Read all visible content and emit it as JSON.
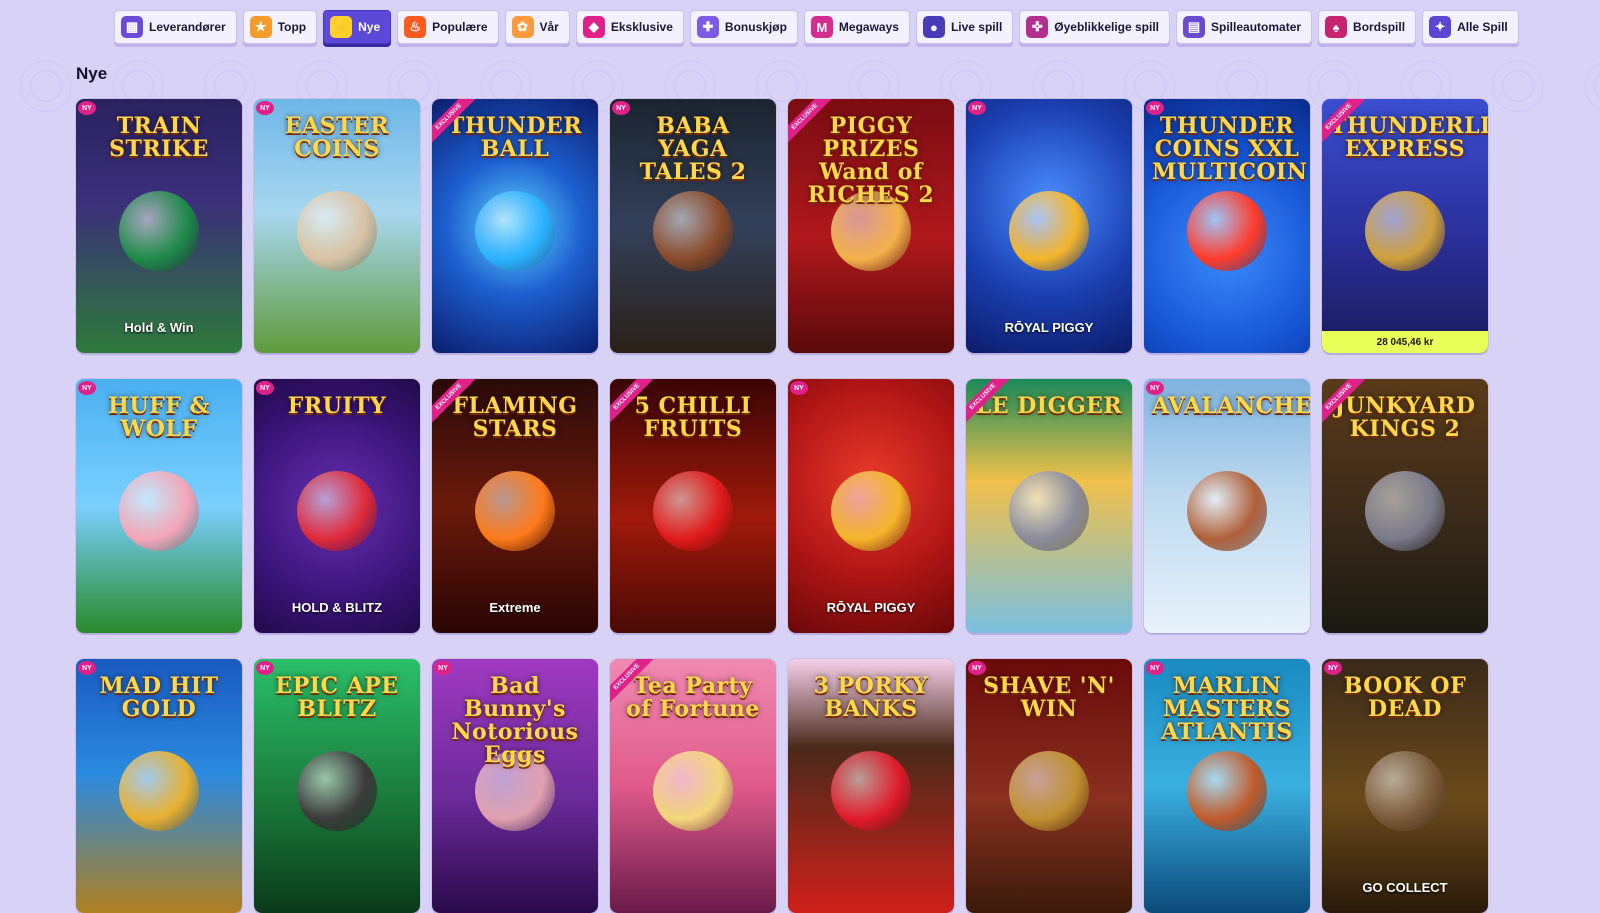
{
  "nav": [
    {
      "label": "Leverandører",
      "icon": "providers-icon",
      "color": "#6b4ad8",
      "glyph": "▦",
      "active": false
    },
    {
      "label": "Topp",
      "icon": "top-icon",
      "color": "#f39b2b",
      "glyph": "★",
      "active": false
    },
    {
      "label": "Nye",
      "icon": "new-icon",
      "color": "#ffcf2b",
      "glyph": "⚡",
      "active": true
    },
    {
      "label": "Populære",
      "icon": "fire-icon",
      "color": "#ff5a1f",
      "glyph": "♨",
      "active": false
    },
    {
      "label": "Vår",
      "icon": "butterfly-icon",
      "color": "#ff9a3c",
      "glyph": "✿",
      "active": false
    },
    {
      "label": "Eksklusive",
      "icon": "gem-icon",
      "color": "#e0218a",
      "glyph": "◆",
      "active": false
    },
    {
      "label": "Bonuskjøp",
      "icon": "gift-icon",
      "color": "#7d5be6",
      "glyph": "✚",
      "active": false
    },
    {
      "label": "Megaways",
      "icon": "megaways-icon",
      "color": "#d42c8f",
      "glyph": "M",
      "active": false
    },
    {
      "label": "Live spill",
      "icon": "live-icon",
      "color": "#4a3bb8",
      "glyph": "●",
      "active": false
    },
    {
      "label": "Øyeblikkelige spill",
      "icon": "gamepad-icon",
      "color": "#b22f8e",
      "glyph": "✜",
      "active": false
    },
    {
      "label": "Spilleautomater",
      "icon": "slot-machine-icon",
      "color": "#6a4ad0",
      "glyph": "▤",
      "active": false
    },
    {
      "label": "Bordspill",
      "icon": "cards-icon",
      "color": "#c8236f",
      "glyph": "♠",
      "active": false
    },
    {
      "label": "Alle Spill",
      "icon": "all-games-icon",
      "color": "#5b46d4",
      "glyph": "✦",
      "active": false
    }
  ],
  "section_title": "Nye",
  "games": [
    {
      "title": "TRAIN STRIKE",
      "sub": "Hold & Win",
      "badge": "NY",
      "exclusive": false,
      "bg": "linear-gradient(180deg,#2a2260 0%,#3b2f7a 40%,#2d7a3a 100%)",
      "emblem": "#1f8a4a"
    },
    {
      "title": "EASTER COINS",
      "sub": "",
      "badge": "NY",
      "exclusive": false,
      "bg": "linear-gradient(180deg,#6fb7e8 0%,#a8d7ef 45%,#5f9a3a 100%)",
      "emblem": "#d9c2a4"
    },
    {
      "title": "THUNDER BALL",
      "sub": "",
      "badge": "",
      "exclusive": true,
      "bg": "radial-gradient(circle at 50% 50%,#5fd8ff 0%,#1d5fd0 45%,#0b1d6e 100%)",
      "emblem": "#2ab3ff"
    },
    {
      "title": "BABA YAGA TALES 2",
      "sub": "",
      "badge": "NY",
      "exclusive": false,
      "bg": "linear-gradient(180deg,#1b2430 0%,#33405a 50%,#2a2018 100%)",
      "emblem": "#8a4a2a"
    },
    {
      "title": "PIGGY PRIZES Wand of RICHES 2",
      "sub": "",
      "badge": "",
      "exclusive": true,
      "bg": "linear-gradient(180deg,#7a0d12 0%,#b0181c 55%,#5a0a0a 100%)",
      "emblem": "#f3b24a"
    },
    {
      "title": "",
      "sub": "RŌYAL PIGGY",
      "badge": "NY",
      "exclusive": false,
      "bg": "radial-gradient(circle at 50% 40%,#4a8cff 0%,#1a3fb0 55%,#0c1c6a 100%)",
      "emblem": "#f5b52a"
    },
    {
      "title": "THUNDER COINS XXL MULTICOIN",
      "sub": "",
      "badge": "NY",
      "exclusive": false,
      "bg": "radial-gradient(circle at 50% 60%,#3b8bff 0%,#1552d0 60%,#0a2a8a 100%)",
      "emblem": "#ff3b2a"
    },
    {
      "title": "THUNDERLINE EXPRESS",
      "sub": "",
      "badge": "",
      "exclusive": true,
      "bg": "linear-gradient(180deg,#3a4ecf 0%,#2a2f9a 55%,#1a1a5a 100%)",
      "emblem": "#d0a03a",
      "jackpot": "28 045,46 kr"
    },
    {
      "title": "HUFF & WOLF",
      "sub": "",
      "badge": "NY",
      "exclusive": false,
      "bg": "linear-gradient(180deg,#4ab0f0 0%,#7ad0ff 50%,#2a8a2a 100%)",
      "emblem": "#f4a6b8"
    },
    {
      "title": "FRUITY",
      "sub": "HOLD & BLITZ",
      "badge": "NY",
      "exclusive": false,
      "bg": "radial-gradient(circle at 50% 50%,#6a2fb0 0%,#3a157a 60%,#22094a 100%)",
      "emblem": "#e02a3a"
    },
    {
      "title": "FLAMING STARS",
      "sub": "Extreme",
      "badge": "",
      "exclusive": true,
      "bg": "linear-gradient(180deg,#2a0a0a 0%,#6a1a0a 50%,#2a0505 100%)",
      "emblem": "#ff7a1a"
    },
    {
      "title": "5 CHILLI FRUITS",
      "sub": "",
      "badge": "",
      "exclusive": true,
      "bg": "linear-gradient(180deg,#3a0505 0%,#a01a0a 55%,#4a0a05 100%)",
      "emblem": "#e01a1a"
    },
    {
      "title": "",
      "sub": "RŌYAL PIGGY",
      "badge": "NY",
      "exclusive": false,
      "bg": "radial-gradient(circle at 50% 40%,#e83a2a 0%,#b01515 55%,#6a0808 100%)",
      "emblem": "#f5b52a"
    },
    {
      "title": "LE DIGGER",
      "sub": "",
      "badge": "",
      "exclusive": true,
      "bg": "linear-gradient(180deg,#1a8a5a 0%,#f0c04a 40%,#7ac0e0 100%)",
      "emblem": "#8a8a9a"
    },
    {
      "title": "AVALANCHE",
      "sub": "",
      "badge": "NY",
      "exclusive": false,
      "bg": "linear-gradient(180deg,#7fb3e0 0%,#bcd9ef 45%,#e8f2fb 100%)",
      "emblem": "#b0603a"
    },
    {
      "title": "JUNKYARD KINGS 2",
      "sub": "",
      "badge": "",
      "exclusive": true,
      "bg": "linear-gradient(180deg,#5a3a1a 0%,#3a2a1a 55%,#1a1a12 100%)",
      "emblem": "#7a7a8a"
    },
    {
      "title": "MAD HIT GOLD",
      "sub": "",
      "badge": "NY",
      "exclusive": false,
      "bg": "linear-gradient(180deg,#1a5ac0 0%,#2a8ae0 45%,#b08020 100%)",
      "emblem": "#e8b030"
    },
    {
      "title": "EPIC APE BLITZ",
      "sub": "",
      "badge": "NY",
      "exclusive": false,
      "bg": "linear-gradient(180deg,#2ac06a 0%,#1a7a3a 55%,#0a3a1a 100%)",
      "emblem": "#3a3a3a"
    },
    {
      "title": "Bad Bunny's Notorious Eggs",
      "sub": "",
      "badge": "NY",
      "exclusive": false,
      "bg": "linear-gradient(180deg,#a03ac0 0%,#6a2a9a 55%,#2a0a4a 100%)",
      "emblem": "#e0a0b0"
    },
    {
      "title": "Tea Party of Fortune",
      "sub": "",
      "badge": "",
      "exclusive": true,
      "bg": "linear-gradient(180deg,#f08ab0 0%,#e05a8a 50%,#6a1a4a 100%)",
      "emblem": "#f3d67a"
    },
    {
      "title": "3 PORKY BANKS",
      "sub": "",
      "badge": "",
      "exclusive": false,
      "bg": "linear-gradient(180deg,#f7d0ea 0%,#4a2a1a 35%,#d0201a 100%)",
      "emblem": "#e01a2a"
    },
    {
      "title": "SHAVE 'N' WIN",
      "sub": "",
      "badge": "NY",
      "exclusive": false,
      "bg": "linear-gradient(180deg,#6a0a0a 0%,#8a3020 55%,#3a1a0a 100%)",
      "emblem": "#c09030"
    },
    {
      "title": "MARLIN MASTERS ATLANTIS",
      "sub": "",
      "badge": "NY",
      "exclusive": false,
      "bg": "linear-gradient(180deg,#1a8ac0 0%,#3ab0e0 50%,#0a4a7a 100%)",
      "emblem": "#c05a2a"
    },
    {
      "title": "BOOK OF DEAD",
      "sub": "GO COLLECT",
      "badge": "NY",
      "exclusive": false,
      "bg": "linear-gradient(180deg,#3a2a1a 0%,#6a4a1a 55%,#2a1a0a 100%)",
      "emblem": "#7a5a3a"
    }
  ]
}
